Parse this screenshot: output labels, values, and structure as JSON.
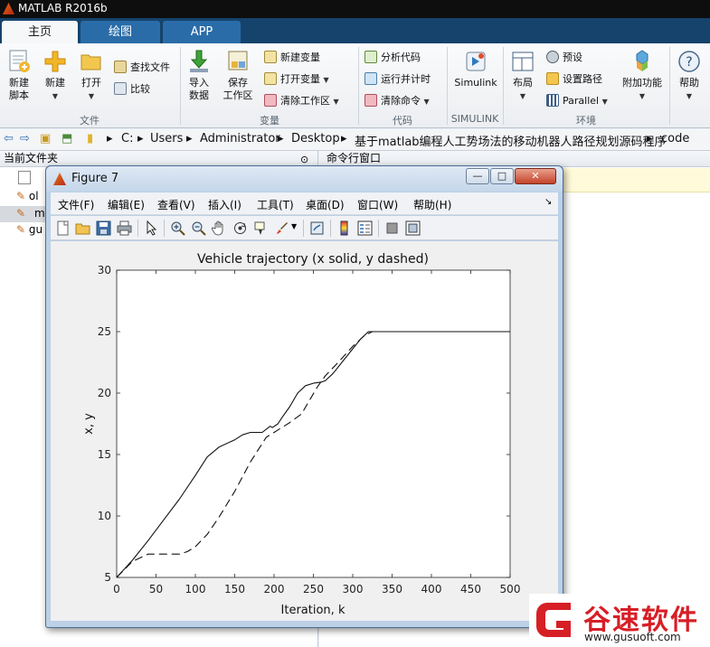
{
  "app": {
    "title": "MATLAB R2016b"
  },
  "tabs": [
    {
      "label": "主页"
    },
    {
      "label": "绘图"
    },
    {
      "label": "APP"
    }
  ],
  "ribbon": {
    "new_script": "新建\n脚本",
    "new": "新建",
    "open": "打开",
    "find_files": "查找文件",
    "compare": "比较",
    "group_file": "文件",
    "import_data": "导入\n数据",
    "save_workspace": "保存\n工作区",
    "new_variable": "新建变量",
    "open_variable": "打开变量",
    "clear_workspace": "清除工作区",
    "group_variable": "变量",
    "analyze_code": "分析代码",
    "run_and_time": "运行并计时",
    "clear_commands": "清除命令",
    "group_code": "代码",
    "simulink": "Simulink",
    "group_simulink": "SIMULINK",
    "layout": "布局",
    "preferences": "预设",
    "set_path": "设置路径",
    "parallel": "Parallel",
    "addons": "附加功能",
    "group_env": "环境",
    "help": "帮助"
  },
  "address": {
    "segments": [
      "C:",
      "Users",
      "Administrator",
      "Desktop",
      "基于matlab编程人工势场法的移动机器人路径规划源码程序",
      "code"
    ]
  },
  "panels": {
    "current_folder": "当前文件夹",
    "command_window": "命令行窗口",
    "file_stubs": [
      "ol",
      "m",
      "gu"
    ]
  },
  "figure": {
    "title": "Figure 7",
    "menu": [
      "文件(F)",
      "编辑(E)",
      "查看(V)",
      "插入(I)",
      "工具(T)",
      "桌面(D)",
      "窗口(W)",
      "帮助(H)"
    ],
    "win_min": "—",
    "win_max": "□",
    "win_close": "✕"
  },
  "chart_data": {
    "type": "line",
    "title": "Vehicle trajectory (x solid, y dashed)",
    "xlabel": "Iteration, k",
    "ylabel": "x, y",
    "xlim": [
      0,
      500
    ],
    "ylim": [
      5,
      30
    ],
    "xticks": [
      0,
      50,
      100,
      150,
      200,
      250,
      300,
      350,
      400,
      450,
      500
    ],
    "yticks": [
      5,
      10,
      15,
      20,
      25,
      30
    ],
    "grid": false,
    "series": [
      {
        "style": "solid",
        "x": [
          0,
          20,
          40,
          60,
          80,
          100,
          115,
          130,
          150,
          160,
          170,
          185,
          195,
          198,
          205,
          210,
          220,
          230,
          240,
          250,
          260,
          265,
          275,
          290,
          300,
          310,
          320,
          325,
          330,
          350,
          400,
          450,
          500
        ],
        "y": [
          5,
          6.4,
          8.0,
          9.7,
          11.4,
          13.3,
          14.8,
          15.6,
          16.2,
          16.6,
          16.8,
          16.8,
          17.3,
          17.2,
          17.5,
          18.0,
          18.9,
          20.0,
          20.6,
          20.8,
          20.9,
          21.0,
          21.6,
          22.8,
          23.6,
          24.4,
          25.0,
          25.0,
          25.0,
          25.0,
          25.0,
          25.0,
          25.0
        ]
      },
      {
        "style": "dashed",
        "x": [
          0,
          20,
          40,
          60,
          80,
          90,
          100,
          115,
          130,
          150,
          170,
          190,
          205,
          220,
          235,
          245,
          255,
          265,
          280,
          300,
          315,
          325,
          330,
          350,
          400,
          450,
          500
        ],
        "y": [
          5,
          6.3,
          6.9,
          6.9,
          6.9,
          7.1,
          7.5,
          8.5,
          9.9,
          12.0,
          14.4,
          16.4,
          17.0,
          17.6,
          18.3,
          19.4,
          20.5,
          21.4,
          22.4,
          23.8,
          24.7,
          25.0,
          25.0,
          25.0,
          25.0,
          25.0,
          25.0
        ]
      }
    ]
  },
  "watermark": {
    "name": "谷速软件",
    "url": "www.gusuoft.com"
  },
  "colors": {
    "tabstrip": "#15436c",
    "ribbon_bg": "#f4f5f7",
    "watermark_red": "#d71f26"
  }
}
